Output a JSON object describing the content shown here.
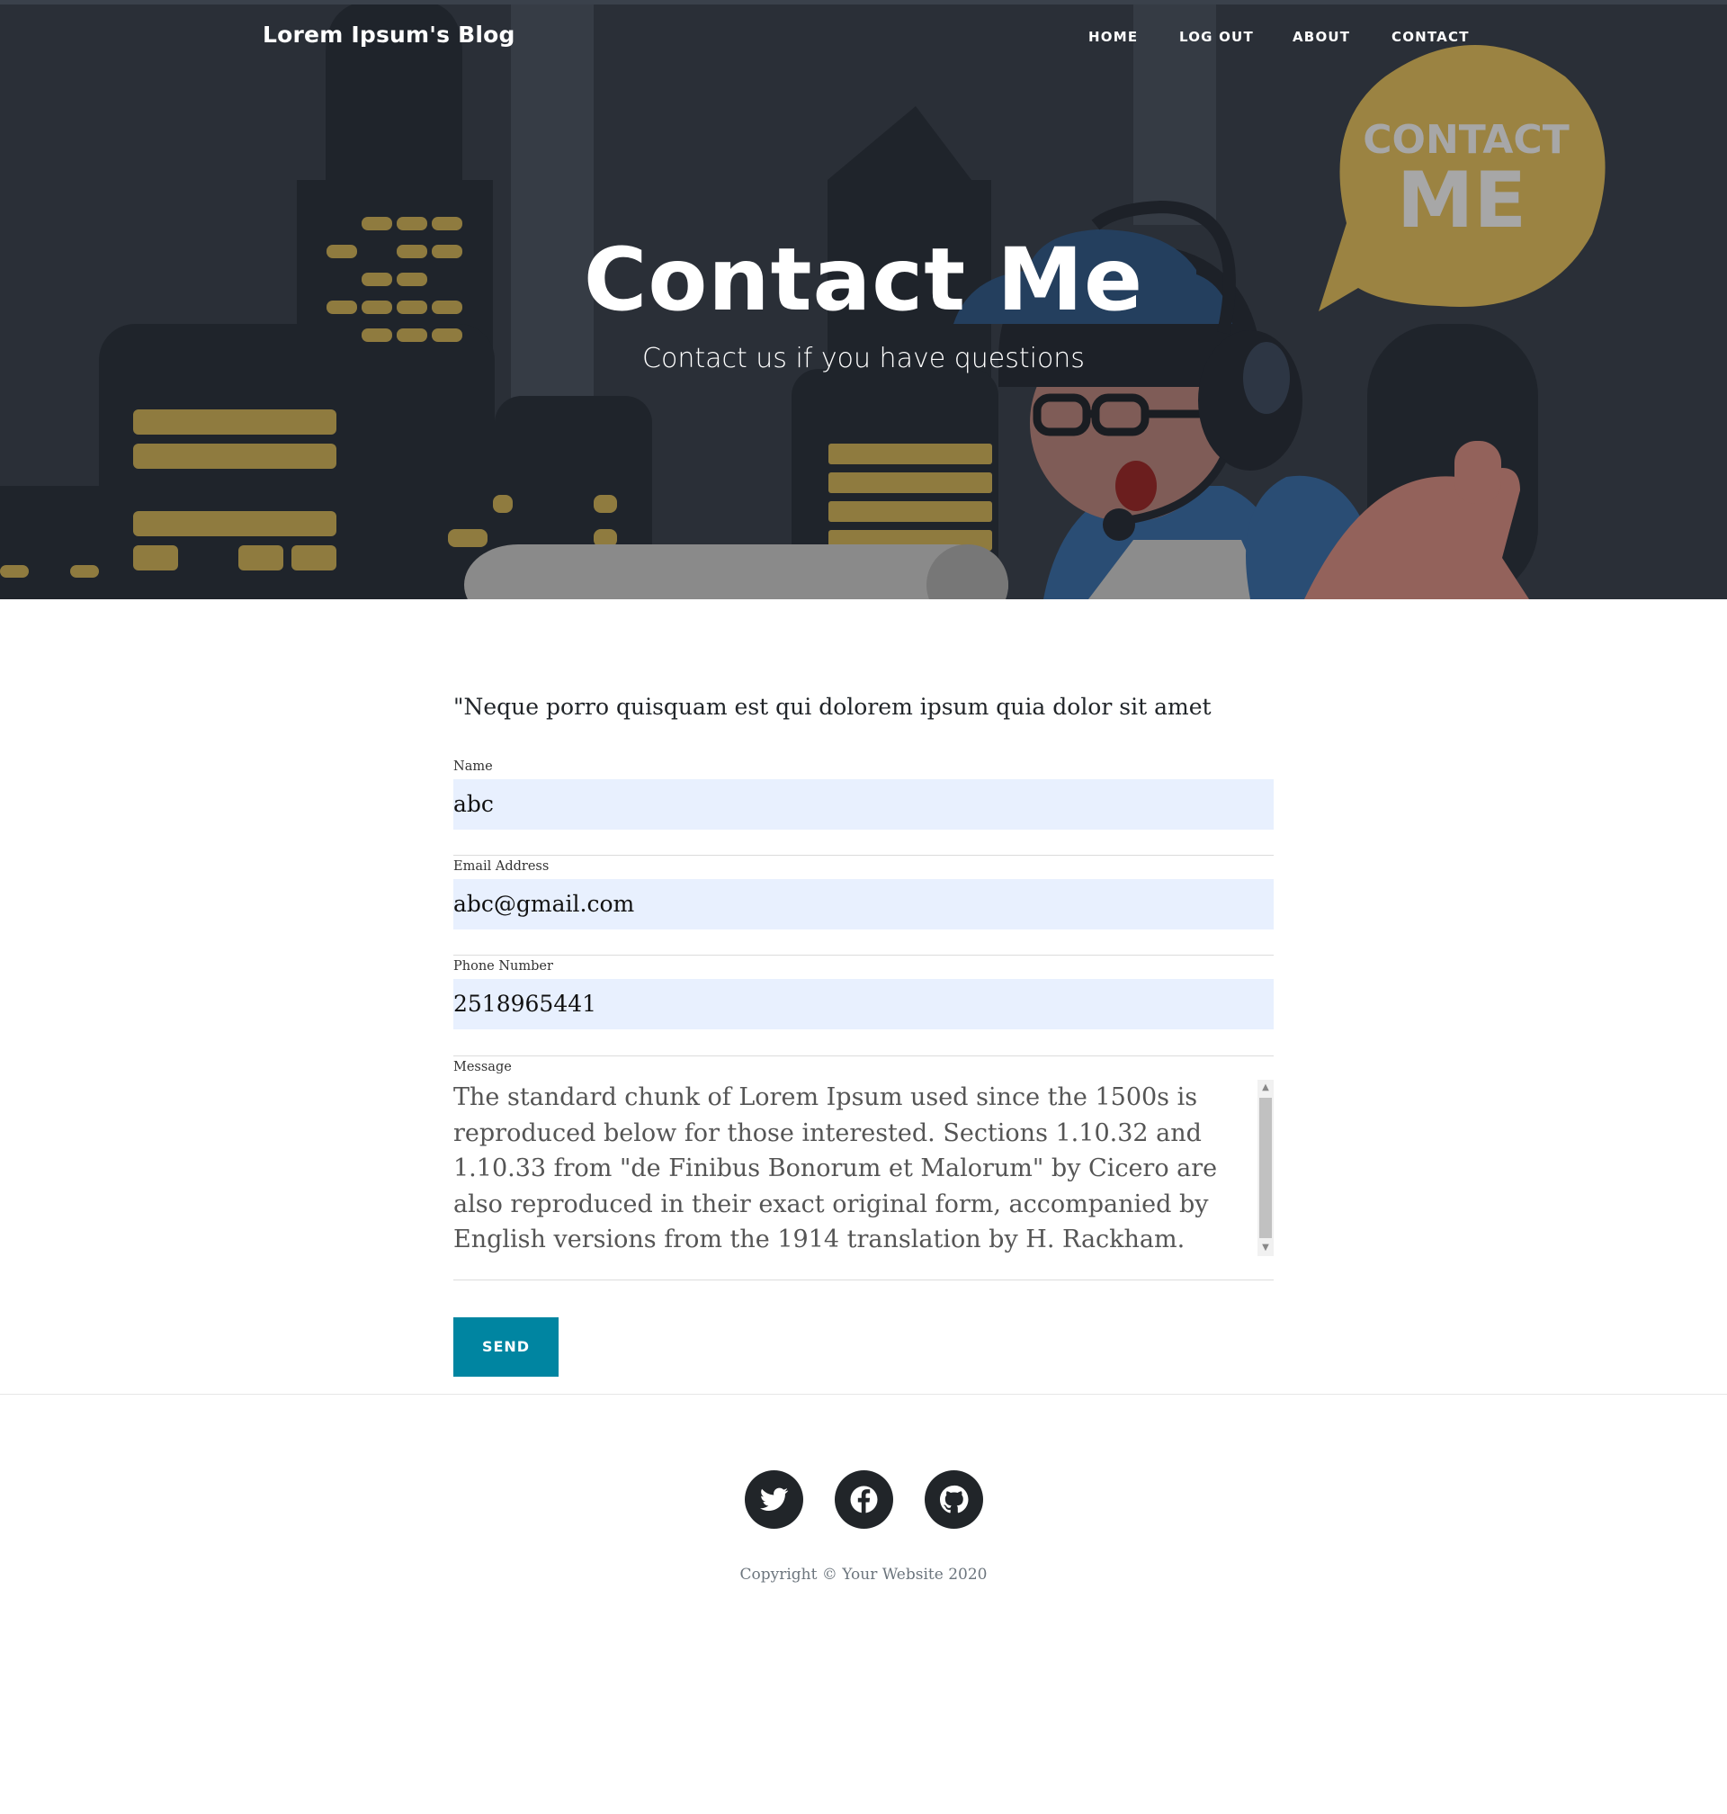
{
  "navbar": {
    "brand": "Lorem Ipsum's Blog",
    "items": [
      {
        "label": "HOME"
      },
      {
        "label": "LOG OUT"
      },
      {
        "label": "ABOUT"
      },
      {
        "label": "CONTACT"
      }
    ]
  },
  "hero": {
    "title": "Contact Me",
    "subtitle": "Contact us if you have questions",
    "bubble_text_line1": "CONTACT",
    "bubble_text_line2": "ME"
  },
  "form": {
    "intro": "\"Neque porro quisquam est qui dolorem ipsum quia dolor sit amet",
    "name": {
      "label": "Name",
      "value": "abc"
    },
    "email": {
      "label": "Email Address",
      "value": "abc@gmail.com"
    },
    "phone": {
      "label": "Phone Number",
      "value": "2518965441"
    },
    "message": {
      "label": "Message",
      "value": "The standard chunk of Lorem Ipsum used since the 1500s is reproduced below for those interested. Sections 1.10.32 and 1.10.33 from \"de Finibus Bonorum et Malorum\" by Cicero are also reproduced in their exact original form, accompanied by English versions from the 1914 translation by H. Rackham."
    },
    "send_label": "SEND"
  },
  "footer": {
    "social": [
      {
        "icon": "twitter-icon"
      },
      {
        "icon": "facebook-icon"
      },
      {
        "icon": "github-icon"
      }
    ],
    "copyright": "Copyright © Your Website 2020"
  },
  "colors": {
    "hero_bg": "#2a2f37",
    "accent_gold": "#9b8342",
    "button": "#0085a1",
    "input_bg": "#e8f0fe",
    "footer_icon": "#212529"
  }
}
